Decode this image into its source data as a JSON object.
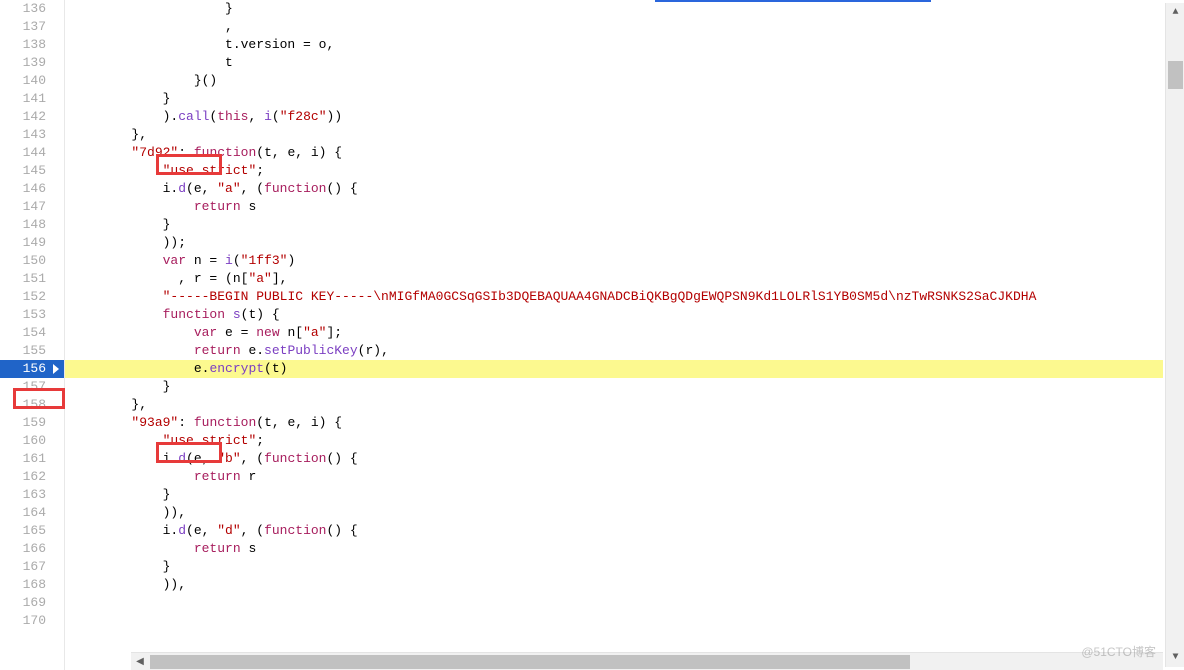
{
  "editor": {
    "first_line_number": 136,
    "last_line_number": 170,
    "active_line_number": 156,
    "highlight_marks": [
      "7d92",
      "93a9"
    ],
    "lines": [
      {
        "n": 136,
        "tokens": [
          {
            "t": "                    }",
            "c": ""
          }
        ]
      },
      {
        "n": 137,
        "tokens": [
          {
            "t": "                    ,",
            "c": ""
          }
        ]
      },
      {
        "n": 138,
        "tokens": [
          {
            "t": "                    t.version = o,",
            "c": ""
          }
        ]
      },
      {
        "n": 139,
        "tokens": [
          {
            "t": "                    t",
            "c": ""
          }
        ]
      },
      {
        "n": 140,
        "tokens": [
          {
            "t": "                }()",
            "c": ""
          }
        ]
      },
      {
        "n": 141,
        "tokens": [
          {
            "t": "            }",
            "c": ""
          }
        ]
      },
      {
        "n": 142,
        "tokens": [
          {
            "t": "            ).",
            "c": ""
          },
          {
            "t": "call",
            "c": "fn"
          },
          {
            "t": "(",
            "c": ""
          },
          {
            "t": "this",
            "c": "kw"
          },
          {
            "t": ", ",
            "c": ""
          },
          {
            "t": "i",
            "c": "fn"
          },
          {
            "t": "(",
            "c": ""
          },
          {
            "t": "\"f28c\"",
            "c": "str"
          },
          {
            "t": "))",
            "c": ""
          }
        ]
      },
      {
        "n": 143,
        "tokens": [
          {
            "t": "        },",
            "c": ""
          }
        ]
      },
      {
        "n": 144,
        "tokens": [
          {
            "t": "        ",
            "c": ""
          },
          {
            "t": "\"7d92\"",
            "c": "str"
          },
          {
            "t": ": ",
            "c": ""
          },
          {
            "t": "function",
            "c": "kw"
          },
          {
            "t": "(t, e, i) {",
            "c": ""
          }
        ]
      },
      {
        "n": 145,
        "tokens": [
          {
            "t": "            ",
            "c": ""
          },
          {
            "t": "\"use strict\"",
            "c": "str"
          },
          {
            "t": ";",
            "c": ""
          }
        ]
      },
      {
        "n": 146,
        "tokens": [
          {
            "t": "            i.",
            "c": ""
          },
          {
            "t": "d",
            "c": "fn"
          },
          {
            "t": "(e, ",
            "c": ""
          },
          {
            "t": "\"a\"",
            "c": "str"
          },
          {
            "t": ", (",
            "c": ""
          },
          {
            "t": "function",
            "c": "kw"
          },
          {
            "t": "() {",
            "c": ""
          }
        ]
      },
      {
        "n": 147,
        "tokens": [
          {
            "t": "                ",
            "c": ""
          },
          {
            "t": "return",
            "c": "kw"
          },
          {
            "t": " s",
            "c": ""
          }
        ]
      },
      {
        "n": 148,
        "tokens": [
          {
            "t": "            }",
            "c": ""
          }
        ]
      },
      {
        "n": 149,
        "tokens": [
          {
            "t": "            ));",
            "c": ""
          }
        ]
      },
      {
        "n": 150,
        "tokens": [
          {
            "t": "            ",
            "c": ""
          },
          {
            "t": "var",
            "c": "kw"
          },
          {
            "t": " n = ",
            "c": ""
          },
          {
            "t": "i",
            "c": "fn"
          },
          {
            "t": "(",
            "c": ""
          },
          {
            "t": "\"1ff3\"",
            "c": "str"
          },
          {
            "t": ")",
            "c": ""
          }
        ]
      },
      {
        "n": 151,
        "tokens": [
          {
            "t": "              , r = (n[",
            "c": ""
          },
          {
            "t": "\"a\"",
            "c": "str"
          },
          {
            "t": "],",
            "c": ""
          }
        ]
      },
      {
        "n": 152,
        "tokens": [
          {
            "t": "            ",
            "c": ""
          },
          {
            "t": "\"-----BEGIN PUBLIC KEY-----\\nMIGfMA0GCSqGSIb3DQEBAQUAA4GNADCBiQKBgQDgEWQPSN9Kd1LOLRlS1YB0SM5d\\nzTwRSNKS2SaCJKDHA",
            "c": "str"
          }
        ]
      },
      {
        "n": 153,
        "tokens": [
          {
            "t": "            ",
            "c": ""
          },
          {
            "t": "function",
            "c": "kw"
          },
          {
            "t": " ",
            "c": ""
          },
          {
            "t": "s",
            "c": "fn"
          },
          {
            "t": "(t) {",
            "c": ""
          }
        ]
      },
      {
        "n": 154,
        "tokens": [
          {
            "t": "                ",
            "c": ""
          },
          {
            "t": "var",
            "c": "kw"
          },
          {
            "t": " e = ",
            "c": ""
          },
          {
            "t": "new",
            "c": "kw"
          },
          {
            "t": " n[",
            "c": ""
          },
          {
            "t": "\"a\"",
            "c": "str"
          },
          {
            "t": "];",
            "c": ""
          }
        ]
      },
      {
        "n": 155,
        "tokens": [
          {
            "t": "                ",
            "c": ""
          },
          {
            "t": "return",
            "c": "kw"
          },
          {
            "t": " e.",
            "c": ""
          },
          {
            "t": "setPublicKey",
            "c": "fn"
          },
          {
            "t": "(r),",
            "c": ""
          }
        ]
      },
      {
        "n": 156,
        "hl": true,
        "tokens": [
          {
            "t": "                e.",
            "c": ""
          },
          {
            "t": "encrypt",
            "c": "fn"
          },
          {
            "t": "(t)",
            "c": ""
          }
        ]
      },
      {
        "n": 157,
        "tokens": [
          {
            "t": "            }",
            "c": ""
          }
        ]
      },
      {
        "n": 158,
        "tokens": [
          {
            "t": "        },",
            "c": ""
          }
        ]
      },
      {
        "n": 159,
        "tokens": [
          {
            "t": "        ",
            "c": ""
          },
          {
            "t": "\"93a9\"",
            "c": "str"
          },
          {
            "t": ": ",
            "c": ""
          },
          {
            "t": "function",
            "c": "kw"
          },
          {
            "t": "(t, e, i) {",
            "c": ""
          }
        ]
      },
      {
        "n": 160,
        "tokens": [
          {
            "t": "            ",
            "c": ""
          },
          {
            "t": "\"use strict\"",
            "c": "str"
          },
          {
            "t": ";",
            "c": ""
          }
        ]
      },
      {
        "n": 161,
        "tokens": [
          {
            "t": "            i.",
            "c": ""
          },
          {
            "t": "d",
            "c": "fn"
          },
          {
            "t": "(e, ",
            "c": ""
          },
          {
            "t": "\"b\"",
            "c": "str"
          },
          {
            "t": ", (",
            "c": ""
          },
          {
            "t": "function",
            "c": "kw"
          },
          {
            "t": "() {",
            "c": ""
          }
        ]
      },
      {
        "n": 162,
        "tokens": [
          {
            "t": "                ",
            "c": ""
          },
          {
            "t": "return",
            "c": "kw"
          },
          {
            "t": " r",
            "c": ""
          }
        ]
      },
      {
        "n": 163,
        "tokens": [
          {
            "t": "            }",
            "c": ""
          }
        ]
      },
      {
        "n": 164,
        "tokens": [
          {
            "t": "            )),",
            "c": ""
          }
        ]
      },
      {
        "n": 165,
        "tokens": [
          {
            "t": "            i.",
            "c": ""
          },
          {
            "t": "d",
            "c": "fn"
          },
          {
            "t": "(e, ",
            "c": ""
          },
          {
            "t": "\"d\"",
            "c": "str"
          },
          {
            "t": ", (",
            "c": ""
          },
          {
            "t": "function",
            "c": "kw"
          },
          {
            "t": "() {",
            "c": ""
          }
        ]
      },
      {
        "n": 166,
        "tokens": [
          {
            "t": "                ",
            "c": ""
          },
          {
            "t": "return",
            "c": "kw"
          },
          {
            "t": " s",
            "c": ""
          }
        ]
      },
      {
        "n": 167,
        "tokens": [
          {
            "t": "            }",
            "c": ""
          }
        ]
      },
      {
        "n": 168,
        "tokens": [
          {
            "t": "            )),",
            "c": ""
          }
        ]
      },
      {
        "n": 169,
        "tokens": [
          {
            "t": "",
            "c": ""
          }
        ]
      },
      {
        "n": 170,
        "tokens": [
          {
            "t": "",
            "c": ""
          }
        ]
      }
    ]
  },
  "watermark": "@51CTO博客"
}
